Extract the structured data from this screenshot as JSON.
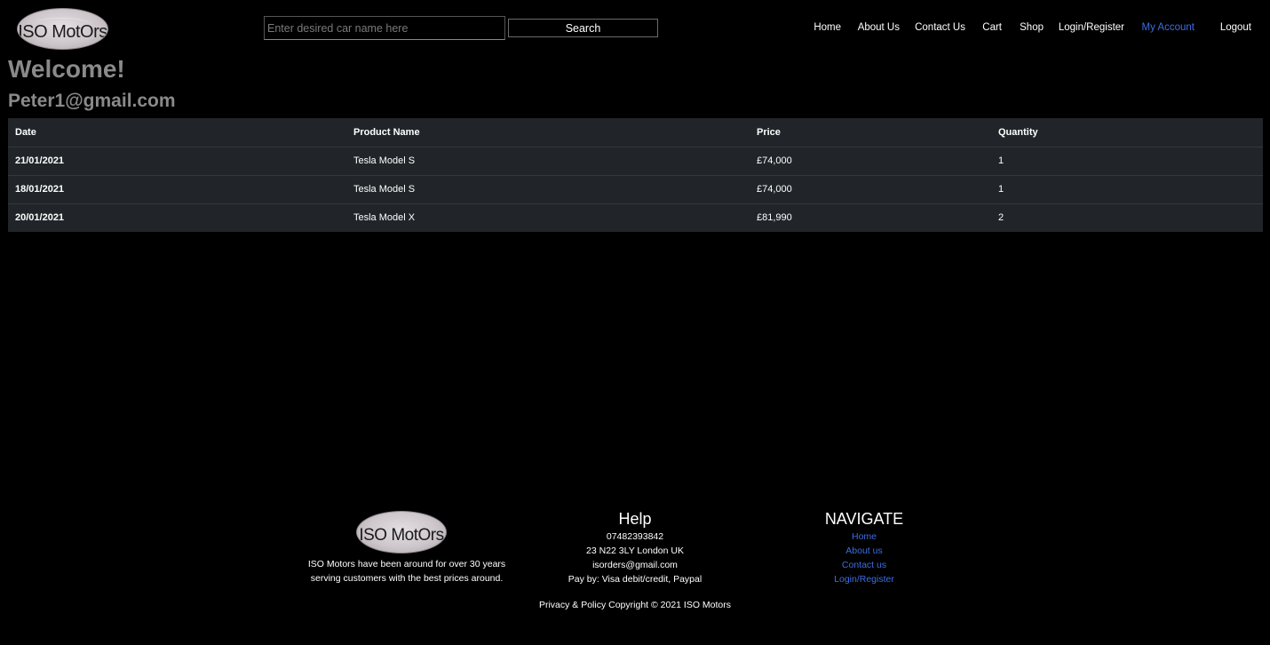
{
  "header": {
    "logo_text": "ISO MotOrs",
    "search": {
      "placeholder": "Enter desired car name here",
      "value": "",
      "button_label": "Search"
    },
    "nav": [
      {
        "label": "Home",
        "active": false
      },
      {
        "label": "About Us",
        "active": false
      },
      {
        "label": "Contact Us",
        "active": false
      },
      {
        "label": "Cart",
        "active": false
      },
      {
        "label": "Shop",
        "active": false
      },
      {
        "label": "Login/Register",
        "active": false
      },
      {
        "label": "My Account",
        "active": true
      },
      {
        "label": "Logout",
        "active": false
      }
    ]
  },
  "account": {
    "welcome": "Welcome!",
    "email": "Peter1@gmail.com"
  },
  "orders": {
    "headers": [
      "Date",
      "Product Name",
      "Price",
      "Quantity"
    ],
    "rows": [
      {
        "date": "21/01/2021",
        "product": "Tesla Model S",
        "price": "£74,000",
        "quantity": "1"
      },
      {
        "date": "18/01/2021",
        "product": "Tesla Model S",
        "price": "£74,000",
        "quantity": "1"
      },
      {
        "date": "20/01/2021",
        "product": "Tesla Model X",
        "price": "£81,990",
        "quantity": "2"
      }
    ]
  },
  "footer": {
    "logo_text": "ISO MotOrs",
    "about_line1": "ISO Motors have been around for over 30 years",
    "about_line2": "serving customers with the best prices around.",
    "help": {
      "title": "Help",
      "phone": "07482393842",
      "address": "23 N22 3LY London UK",
      "email": "isorders@gmail.com",
      "payment": "Pay by: Visa debit/credit, Paypal"
    },
    "navigate": {
      "title": "NAVIGATE",
      "links": [
        "Home",
        "About us",
        "Contact us",
        "Login/Register"
      ]
    },
    "copyright": "Privacy & Policy Copyright © 2021 ISO Motors"
  },
  "colors": {
    "background": "#000000",
    "table_background": "#212529",
    "link_active": "#3d6de0",
    "heading_gray": "#8a8a8a"
  }
}
